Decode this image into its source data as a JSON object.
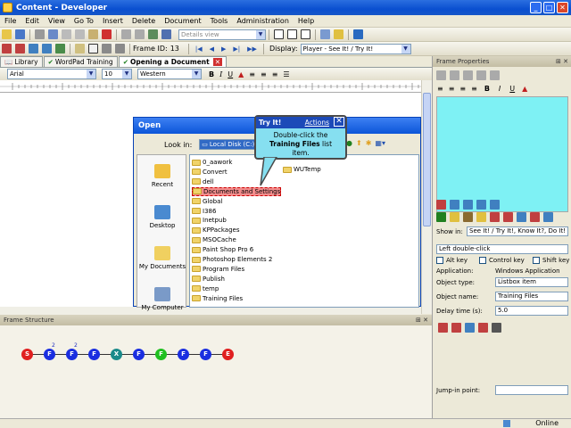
{
  "window": {
    "title": "Content - Developer"
  },
  "menu": [
    "File",
    "Edit",
    "View",
    "Go To",
    "Insert",
    "Delete",
    "Document",
    "Tools",
    "Administration",
    "Help"
  ],
  "toolbar": {
    "view_placeholder": "Details view",
    "frame_id_label": "Frame ID:",
    "frame_id_value": "13",
    "display_label": "Display:",
    "display_value": "Player - See It! / Try It!"
  },
  "doc_tabs": [
    {
      "label": "Library"
    },
    {
      "label": "WordPad Training"
    },
    {
      "label": "Opening a Document"
    }
  ],
  "format": {
    "font": "Arial",
    "size": "10",
    "script": "Western"
  },
  "open_dialog": {
    "title": "Open",
    "look_in_label": "Look in:",
    "look_in_value": "Local Disk (C:)",
    "places": [
      "Recent",
      "Desktop",
      "My Documents",
      "My Computer"
    ],
    "files_col1": [
      "0_aawork",
      "Convert",
      "dell",
      "Documents and Settings",
      "Global",
      "I386",
      "Inetpub",
      "KPPackages",
      "MSOCache",
      "Paint Shop Pro 6",
      "Photoshop Elements 2",
      "Program Files",
      "Publish",
      "temp",
      "Training Files"
    ],
    "files_col2": [
      "WUTemp"
    ]
  },
  "callout": {
    "title": "Try It!",
    "actions": "Actions",
    "close": "✕",
    "text_pre": "Double-click the",
    "text_bold": "Training Files",
    "text_post": " list item."
  },
  "frame_structure": {
    "title": "Frame Structure",
    "nodes": [
      {
        "label": "S",
        "color": "#e02020",
        "badge": ""
      },
      {
        "label": "F",
        "color": "#1a2ee0",
        "badge": "2"
      },
      {
        "label": "F",
        "color": "#1a2ee0",
        "badge": "2"
      },
      {
        "label": "F",
        "color": "#1a2ee0",
        "badge": ""
      },
      {
        "label": "X",
        "color": "#1a8a8a",
        "badge": ""
      },
      {
        "label": "F",
        "color": "#1a2ee0",
        "badge": ""
      },
      {
        "label": "F",
        "color": "#20c020",
        "badge": ""
      },
      {
        "label": "F",
        "color": "#1a2ee0",
        "badge": ""
      },
      {
        "label": "F",
        "color": "#1a2ee0",
        "badge": ""
      },
      {
        "label": "E",
        "color": "#e02020",
        "badge": ""
      }
    ]
  },
  "frame_properties": {
    "title": "Frame Properties",
    "show_in_label": "Show in:",
    "show_in_value": "See It! / Try It!, Know It?, Do It!",
    "action_value": "Left double-click",
    "alt_key": "Alt key",
    "control_key": "Control key",
    "shift_key": "Shift key",
    "application_label": "Application:",
    "application_value": "Windows Application",
    "object_type_label": "Object type:",
    "object_type_value": "Listbox item",
    "object_name_label": "Object name:",
    "object_name_value": "Training Files",
    "delay_label": "Delay time (s):",
    "delay_value": "5.0",
    "jump_label": "Jump-in point:"
  },
  "status": {
    "text": "Online"
  }
}
